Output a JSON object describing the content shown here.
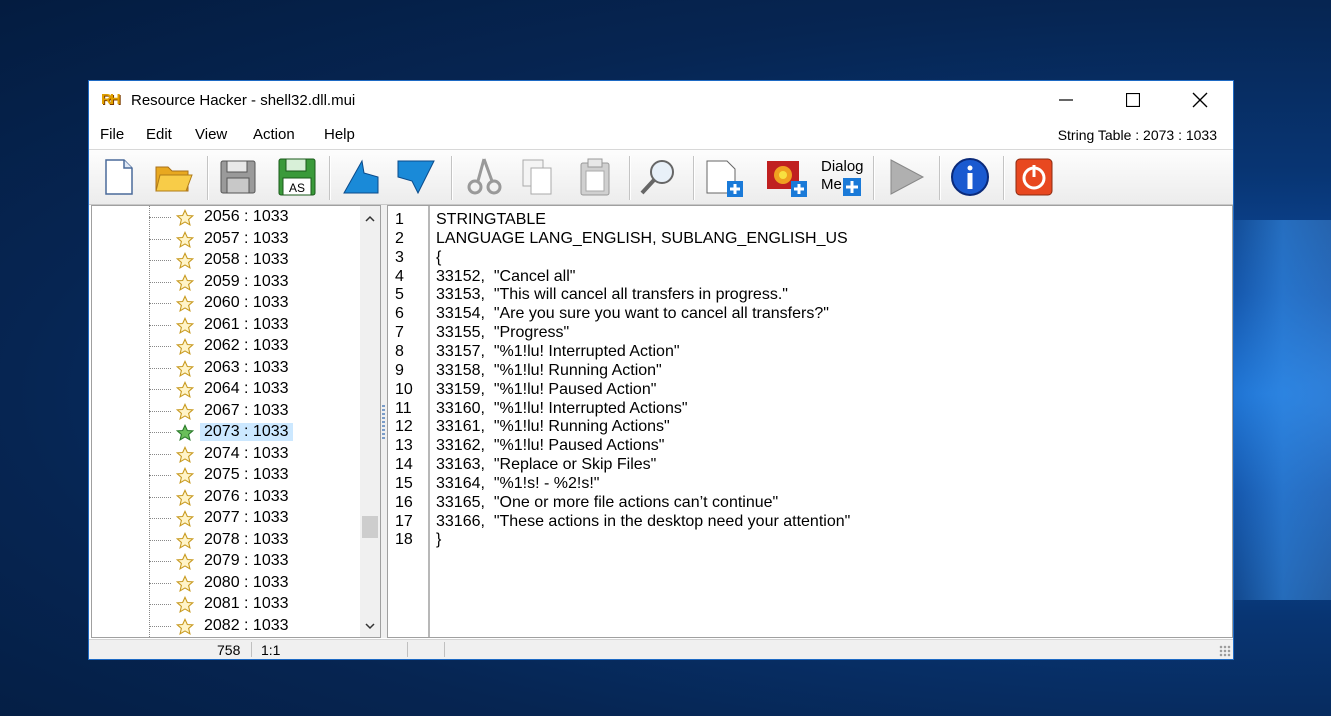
{
  "window": {
    "title": "Resource Hacker - shell32.dll.mui",
    "logo_text": "RH",
    "controls": [
      "minimize-icon",
      "maximize-icon",
      "close-icon"
    ]
  },
  "menu": {
    "items": [
      "File",
      "Edit",
      "View",
      "Action",
      "Help"
    ],
    "status": "String Table : 2073 : 1033"
  },
  "toolbar": {
    "icons": [
      "new-file-icon",
      "open-folder-icon",
      "save-icon",
      "save-as-icon",
      "back-arrow-icon",
      "forward-arrow-icon",
      "cut-icon",
      "copy-icon",
      "paste-icon",
      "find-icon",
      "add-resource-icon",
      "add-image-icon",
      "add-dialog-menu-icon",
      "run-icon",
      "info-icon",
      "exit-icon"
    ],
    "save_as_label": "AS",
    "dialog_menu_label_1": "Dialog",
    "dialog_menu_label_2": "Me"
  },
  "tree": {
    "items": [
      "2056 : 1033",
      "2057 : 1033",
      "2058 : 1033",
      "2059 : 1033",
      "2060 : 1033",
      "2061 : 1033",
      "2062 : 1033",
      "2063 : 1033",
      "2064 : 1033",
      "2067 : 1033",
      "2073 : 1033",
      "2074 : 1033",
      "2075 : 1033",
      "2076 : 1033",
      "2077 : 1033",
      "2078 : 1033",
      "2079 : 1033",
      "2080 : 1033",
      "2081 : 1033",
      "2082 : 1033"
    ],
    "selected": "2073 : 1033"
  },
  "editor": {
    "lines": [
      "STRINGTABLE",
      "LANGUAGE LANG_ENGLISH, SUBLANG_ENGLISH_US",
      "{",
      "33152,  \"Cancel all\"",
      "33153,  \"This will cancel all transfers in progress.\"",
      "33154,  \"Are you sure you want to cancel all transfers?\"",
      "33155,  \"Progress\"",
      "33157,  \"%1!lu! Interrupted Action\"",
      "33158,  \"%1!lu! Running Action\"",
      "33159,  \"%1!lu! Paused Action\"",
      "33160,  \"%1!lu! Interrupted Actions\"",
      "33161,  \"%1!lu! Running Actions\"",
      "33162,  \"%1!lu! Paused Actions\"",
      "33163,  \"Replace or Skip Files\"",
      "33164,  \"%1!s! - %2!s!\"",
      "33165,  \"One or more file actions can’t continue\"",
      "33166,  \"These actions in the desktop need your attention\"",
      "}"
    ],
    "line_numbers": [
      "1",
      "2",
      "3",
      "4",
      "5",
      "6",
      "7",
      "8",
      "9",
      "10",
      "11",
      "12",
      "13",
      "14",
      "15",
      "16",
      "17",
      "18"
    ]
  },
  "statusbar": {
    "count": "758",
    "position": "1:1"
  }
}
